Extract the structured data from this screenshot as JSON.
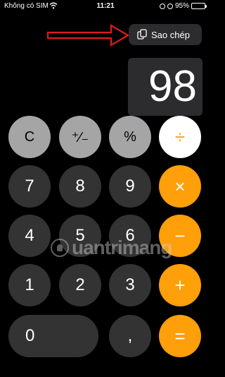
{
  "status_bar": {
    "carrier": "Không có SIM",
    "time": "11:21",
    "battery": "95%",
    "battery_level": 0.95,
    "icons": [
      "wifi-icon",
      "alarm-icon",
      "battery-icon"
    ]
  },
  "popup": {
    "label": "Sao chép",
    "icon": "copy-icon"
  },
  "display": {
    "value": "98"
  },
  "keys": {
    "clear": "C",
    "sign": "⁺∕₋",
    "percent": "%",
    "divide": "÷",
    "seven": "7",
    "eight": "8",
    "nine": "9",
    "multiply": "×",
    "four": "4",
    "five": "5",
    "six": "6",
    "minus": "−",
    "one": "1",
    "two": "2",
    "three": "3",
    "plus": "+",
    "zero": "0",
    "decimal": ",",
    "equals": "="
  },
  "watermark": {
    "text": "uantrimang"
  },
  "colors": {
    "function_key": "#a5a5a5",
    "digit_key": "#333333",
    "operator_key": "#ff9f0a",
    "annotation_arrow": "#e01b1b"
  }
}
